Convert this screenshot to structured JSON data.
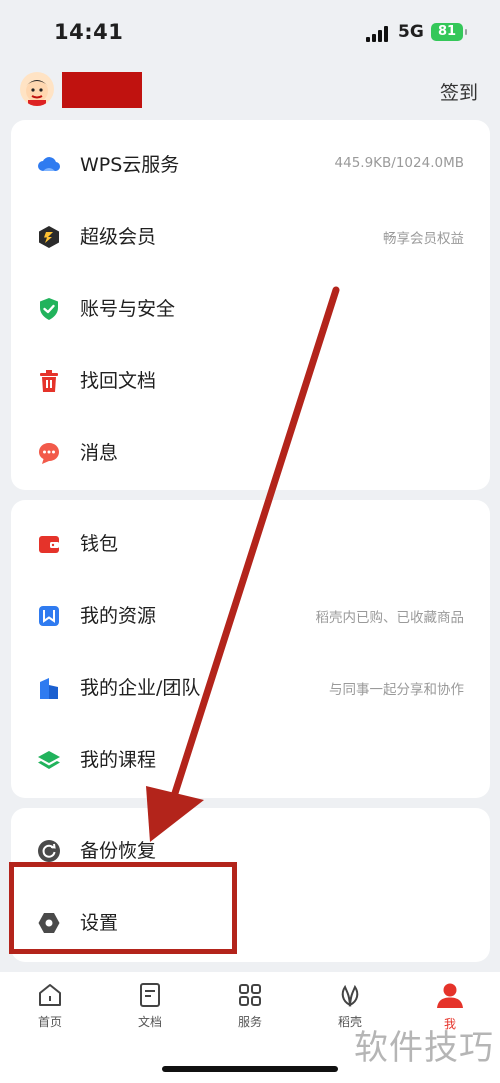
{
  "status": {
    "time": "14:41",
    "network": "5G",
    "battery": "81"
  },
  "header": {
    "signin_label": "签到"
  },
  "card1": [
    {
      "label": "WPS云服务",
      "sub": "445.9KB/1024.0MB",
      "icon": "cloud-icon"
    },
    {
      "label": "超级会员",
      "sub": "畅享会员权益",
      "icon": "super-member-icon"
    },
    {
      "label": "账号与安全",
      "sub": "",
      "icon": "shield-check-icon"
    },
    {
      "label": "找回文档",
      "sub": "",
      "icon": "trash-bin-icon"
    },
    {
      "label": "消息",
      "sub": "",
      "icon": "chat-bubble-icon"
    }
  ],
  "card2": [
    {
      "label": "钱包",
      "sub": "",
      "icon": "wallet-icon"
    },
    {
      "label": "我的资源",
      "sub": "稻壳内已购、已收藏商品",
      "icon": "bookmark-resource-icon"
    },
    {
      "label": "我的企业/团队",
      "sub": "与同事一起分享和协作",
      "icon": "enterprise-icon"
    },
    {
      "label": "我的课程",
      "sub": "",
      "icon": "course-layers-icon"
    }
  ],
  "card3": [
    {
      "label": "备份恢复",
      "sub": "",
      "icon": "backup-restore-icon"
    },
    {
      "label": "设置",
      "sub": "",
      "icon": "settings-hex-icon"
    }
  ],
  "tabbar": [
    {
      "label": "首页",
      "icon": "home-icon"
    },
    {
      "label": "文档",
      "icon": "document-icon"
    },
    {
      "label": "服务",
      "icon": "grid-icon"
    },
    {
      "label": "稻壳",
      "icon": "leaf-icon"
    },
    {
      "label": "我",
      "icon": "person-icon",
      "active": true
    }
  ],
  "watermark": "软件技巧",
  "colors": {
    "accent_red": "#e5332a",
    "annotation_red": "#b3241b",
    "battery_green": "#34c759"
  }
}
